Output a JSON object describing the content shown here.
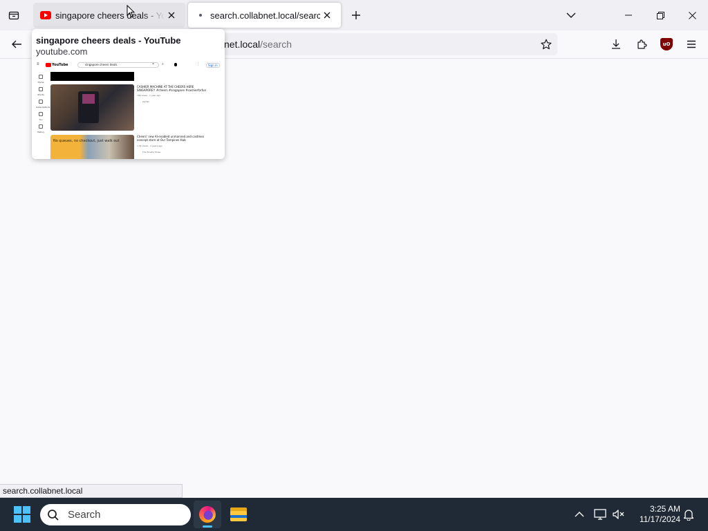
{
  "browser": {
    "tabs": [
      {
        "title": "singapore cheers deals - YouTube",
        "favicon": "youtube-icon",
        "active": false
      },
      {
        "title": "search.collabnet.local/search",
        "favicon": "dot-icon",
        "active": true
      }
    ],
    "url": {
      "host": "collabnet.local",
      "path": "/search",
      "visible_host_fragment": "net.local"
    },
    "toolbar_icons": [
      "back-arrow-icon",
      "star-icon",
      "download-icon",
      "extensions-icon",
      "ublock-origin-icon",
      "menu-icon"
    ],
    "tab_strip_icons": [
      "tab-overview-icon",
      "new-tab-icon",
      "list-all-tabs-icon"
    ],
    "window_controls": [
      "minimize-icon",
      "restore-icon",
      "close-icon"
    ]
  },
  "tab_preview": {
    "title": "singapore cheers deals - YouTube",
    "url": "youtube.com",
    "thumbnail": {
      "logo_text": "YouTube",
      "search_query": "singapore cheers deals",
      "signin_label": "Sign in",
      "sidebar_labels": [
        "Home",
        "Shorts",
        "Subscriptions",
        "You",
        "History"
      ],
      "results": [
        {
          "title": "CASHIER MACHINE AT THE CHEERS HERE SINGAPORE!! #cheers #singapore #cashierforfun",
          "meta": "796 views · 1 year ago",
          "channel": "Jayden"
        },
        {
          "title": "Cheers' new AI-enabled unmanned and cashless concept store at Our Tampines Hub",
          "meta": "1.3K views · 3 years ago",
          "channel": "The Straits Times",
          "thumb_text": "No queues, no checkout, just walk out"
        }
      ]
    }
  },
  "status_bar": {
    "link": "search.collabnet.local"
  },
  "taskbar": {
    "search_placeholder": "Search",
    "apps": [
      {
        "name": "Firefox",
        "active": true
      },
      {
        "name": "File Explorer",
        "active": false
      }
    ],
    "tray_icons": [
      "chevron-up-icon",
      "network-icon",
      "speaker-muted-icon",
      "notification-bell-icon"
    ],
    "time": "3:25 AM",
    "date": "11/17/2024"
  },
  "colors": {
    "tab_strip": "#f0f0f4",
    "taskbar": "#1f2a36",
    "youtube_red": "#ff0000",
    "accent": "#4cc2ff"
  }
}
